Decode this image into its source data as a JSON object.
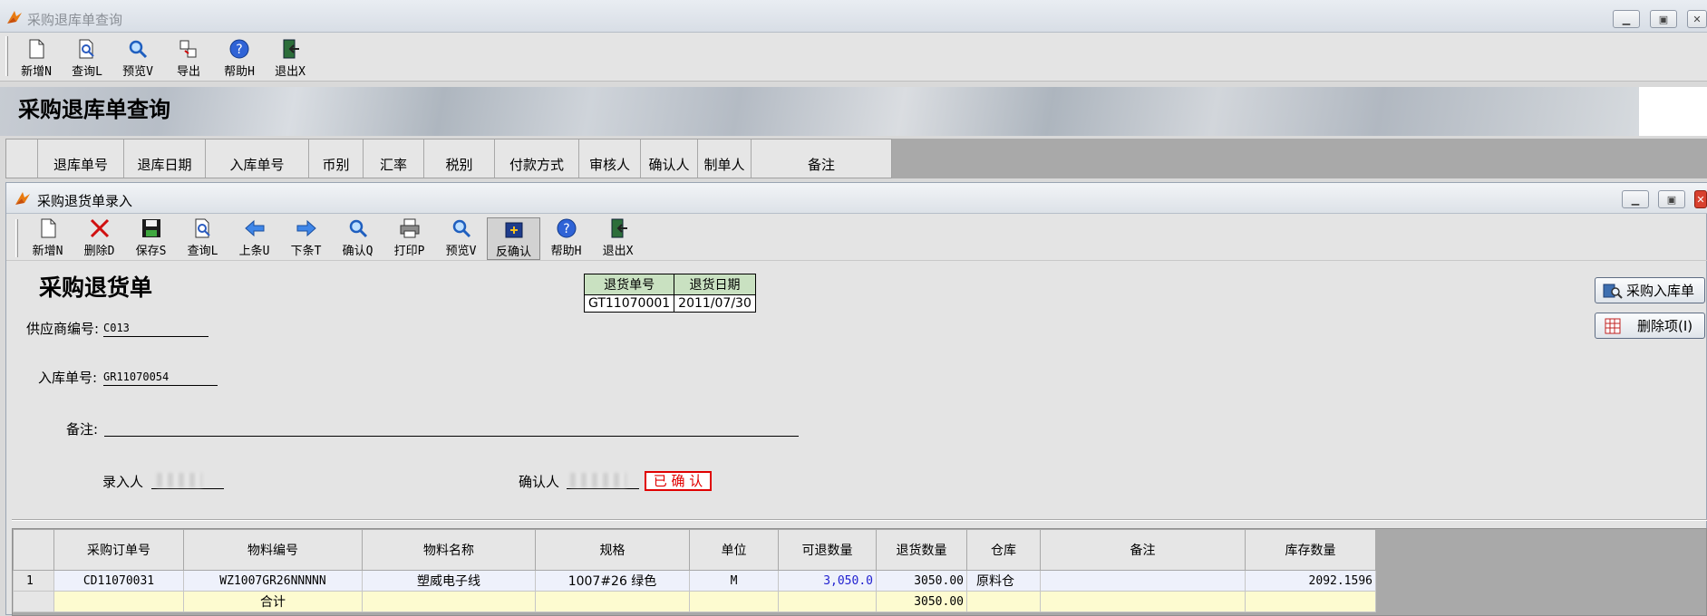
{
  "outer_window": {
    "title": "采购退库单查询",
    "toolbar": [
      {
        "label": "新增N",
        "icon": "new-doc-icon"
      },
      {
        "label": "查询L",
        "icon": "query-icon"
      },
      {
        "label": "预览V",
        "icon": "preview-icon"
      },
      {
        "label": "导出",
        "icon": "export-icon"
      },
      {
        "label": "帮助H",
        "icon": "help-icon"
      },
      {
        "label": "退出X",
        "icon": "exit-icon"
      }
    ],
    "banner_title": "采购退库单查询",
    "columns": [
      "退库单号",
      "退库日期",
      "入库单号",
      "币别",
      "汇率",
      "税别",
      "付款方式",
      "审核人",
      "确认人",
      "制单人",
      "备注"
    ]
  },
  "dialog": {
    "title": "采购退货单录入",
    "toolbar": [
      {
        "label": "新增N",
        "icon": "new-doc-icon"
      },
      {
        "label": "删除D",
        "icon": "delete-icon"
      },
      {
        "label": "保存S",
        "icon": "save-icon"
      },
      {
        "label": "查询L",
        "icon": "query-icon"
      },
      {
        "label": "上条U",
        "icon": "arrow-left-icon"
      },
      {
        "label": "下条T",
        "icon": "arrow-right-icon"
      },
      {
        "label": "确认Q",
        "icon": "confirm-icon"
      },
      {
        "label": "打印P",
        "icon": "print-icon"
      },
      {
        "label": "预览V",
        "icon": "preview-icon"
      },
      {
        "label": "反确认",
        "icon": "unconfirm-icon"
      },
      {
        "label": "帮助H",
        "icon": "help-icon"
      },
      {
        "label": "退出X",
        "icon": "exit-icon"
      }
    ],
    "form_title": "采购退货单",
    "return_info": {
      "no_label": "退货单号",
      "date_label": "退货日期",
      "no_value": "GT11070001",
      "date_value": "2011/07/30"
    },
    "supplier_label": "供应商编号:",
    "supplier_value": "C013",
    "receipt_label": "入库单号:",
    "receipt_value": "GR11070054",
    "remark_label": "备注:",
    "remark_value": "",
    "entered_by_label": "录入人",
    "confirmed_by_label": "确认人",
    "status_stamp": "已 确 认",
    "side_buttons": {
      "purchase_receipt": "采购入库单",
      "delete_item": "删除项(I)"
    },
    "grid": {
      "headers": [
        "采购订单号",
        "物料编号",
        "物料名称",
        "规格",
        "单位",
        "可退数量",
        "退货数量",
        "仓库",
        "备注",
        "库存数量"
      ],
      "rows": [
        {
          "row_no": "1",
          "order_no": "CD11070031",
          "material_code": "WZ1007GR26NNNNN",
          "material_name": "塑威电子线",
          "spec": "1007#26 绿色",
          "unit": "M",
          "returnable_qty": "3,050.0",
          "return_qty": "3050.00",
          "warehouse": "原料仓",
          "remark": "",
          "stock_qty": "2092.1596"
        }
      ],
      "total_label": "合计",
      "total_return_qty": "3050.00"
    }
  },
  "colors": {
    "accent_blue": "#1f1fd0",
    "stamp_red": "#e00000",
    "header_green": "#c9e1c1",
    "sum_row_yellow": "#fdfbd0"
  }
}
